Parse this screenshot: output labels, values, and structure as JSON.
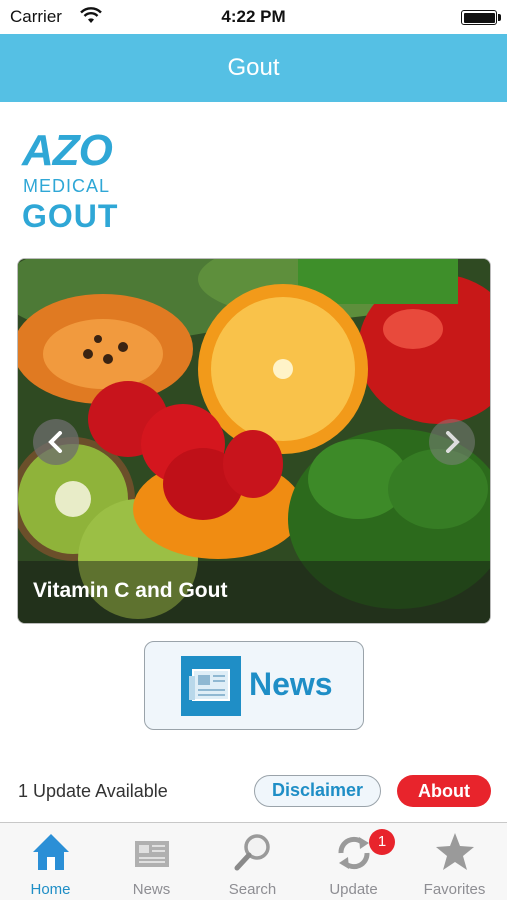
{
  "status_bar": {
    "carrier": "Carrier",
    "time": "4:22 PM",
    "battery_level": 1.0
  },
  "nav": {
    "title": "Gout"
  },
  "logo": {
    "line1": "AZO",
    "line2": "MEDICAL",
    "line3": "GOUT"
  },
  "carousel": {
    "caption": "Vitamin C and Gout"
  },
  "news_button": {
    "label": "News"
  },
  "footer": {
    "update_text": "1 Update Available",
    "disclaimer_label": "Disclaimer",
    "about_label": "About"
  },
  "tabs": [
    {
      "label": "Home",
      "icon": "home-icon",
      "active": true
    },
    {
      "label": "News",
      "icon": "newspaper-icon",
      "active": false
    },
    {
      "label": "Search",
      "icon": "search-icon",
      "active": false
    },
    {
      "label": "Update",
      "icon": "update-icon",
      "active": false,
      "badge": "1"
    },
    {
      "label": "Favorites",
      "icon": "star-icon",
      "active": false
    }
  ],
  "colors": {
    "nav_background": "#55c0e4",
    "brand_blue": "#1f8ec6",
    "about_red": "#e8242c",
    "tab_inactive": "#8e8e93"
  }
}
